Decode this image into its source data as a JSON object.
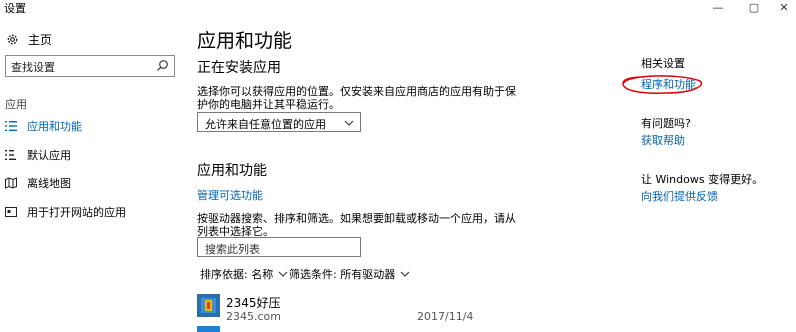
{
  "window": {
    "title": "设置",
    "controls": {
      "minimize": "—",
      "maximize": "▢",
      "close": "✕"
    }
  },
  "sidebar": {
    "home": "主页",
    "search_placeholder": "查找设置",
    "section": "应用",
    "items": [
      {
        "label": "应用和功能",
        "icon": "list-icon",
        "active": true
      },
      {
        "label": "默认应用",
        "icon": "default-apps-icon",
        "active": false
      },
      {
        "label": "离线地图",
        "icon": "map-icon",
        "active": false
      },
      {
        "label": "用于打开网站的应用",
        "icon": "web-apps-icon",
        "active": false
      }
    ]
  },
  "main": {
    "title": "应用和功能",
    "installing": {
      "heading": "正在安装应用",
      "description_line1": "选择你可以获得应用的位置。仅安装来自应用商店的应用有助于保",
      "description_line2": "护你的电脑并让其平稳运行。",
      "dropdown_value": "允许来自任意位置的应用"
    },
    "apps": {
      "heading": "应用和功能",
      "manage_link": "管理可选功能",
      "description_line1": "按驱动器搜索、排序和筛选。如果想要卸载或移动一个应用，请从",
      "description_line2": "列表中选择它。",
      "search_placeholder": "搜索此列表",
      "sort_label": "排序依据: 名称",
      "filter_label": "筛选条件: 所有驱动器",
      "list": [
        {
          "name": "2345好压",
          "publisher": "2345.com",
          "date": "2017/11/4"
        }
      ]
    }
  },
  "right": {
    "related_heading": "相关设置",
    "related_link": "程序和功能",
    "question_heading": "有问题吗?",
    "help_link": "获取帮助",
    "feedback_heading": "让 Windows 变得更好。",
    "feedback_link": "向我们提供反馈"
  },
  "colors": {
    "accent": "#0063b1",
    "annotation": "#e0000b"
  }
}
